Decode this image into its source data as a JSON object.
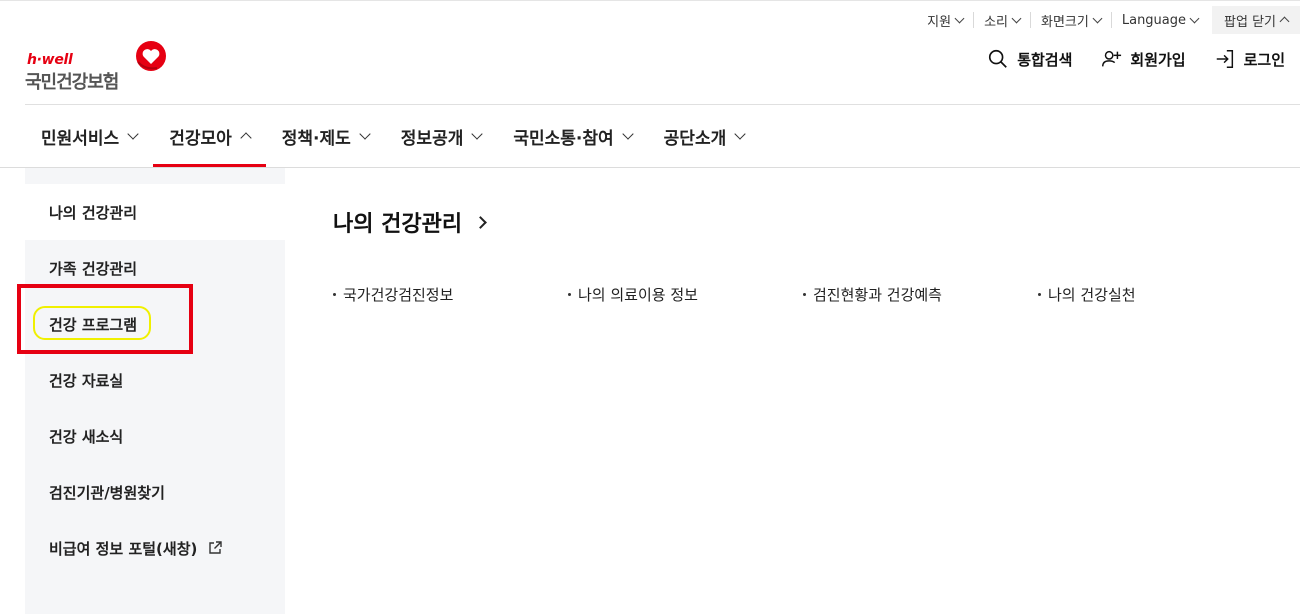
{
  "utility": {
    "items": [
      {
        "label": "지원"
      },
      {
        "label": "소리"
      },
      {
        "label": "화면크기"
      },
      {
        "label": "Language"
      }
    ],
    "popup_label": "팝업 닫기"
  },
  "logo": {
    "sub": "h·well",
    "main": "국민건강보험"
  },
  "header": {
    "search_label": "통합검색",
    "signup_label": "회원가입",
    "login_label": "로그인"
  },
  "gnb": {
    "items": [
      {
        "label": "민원서비스"
      },
      {
        "label": "건강모아"
      },
      {
        "label": "정책·제도"
      },
      {
        "label": "정보공개"
      },
      {
        "label": "국민소통·참여"
      },
      {
        "label": "공단소개"
      }
    ]
  },
  "side": {
    "items": [
      {
        "label": "나의 건강관리"
      },
      {
        "label": "가족 건강관리"
      },
      {
        "label": "건강 프로그램"
      },
      {
        "label": "건강 자료실"
      },
      {
        "label": "건강 새소식"
      },
      {
        "label": "검진기관/병원찾기"
      },
      {
        "label": "비급여 정보 포털(새창)"
      }
    ]
  },
  "content": {
    "title": "나의 건강관리",
    "links": [
      {
        "label": "국가건강검진정보"
      },
      {
        "label": "나의 의료이용 정보"
      },
      {
        "label": "검진현황과 건강예측"
      },
      {
        "label": "나의 건강실천"
      }
    ]
  },
  "colors": {
    "brand_red": "#e60012",
    "highlight_yellow": "#f0f000",
    "side_bg": "#f5f6f8"
  }
}
